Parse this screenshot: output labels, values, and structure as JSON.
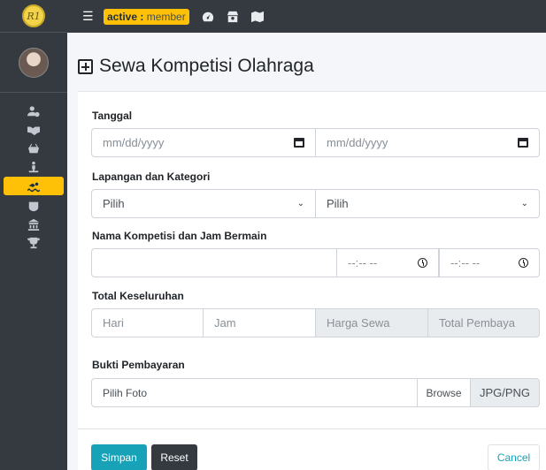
{
  "brand": {
    "logo_text": "R1"
  },
  "sidebar": {
    "items": [
      {
        "icon": "user-cog-icon"
      },
      {
        "icon": "handshake-icon"
      },
      {
        "icon": "basket-icon"
      },
      {
        "icon": "person-icon"
      },
      {
        "icon": "swimmer-icon",
        "active": true
      },
      {
        "icon": "fist-icon"
      },
      {
        "icon": "building-icon"
      },
      {
        "icon": "trophy-icon"
      }
    ]
  },
  "topbar": {
    "badge_prefix": "active : ",
    "badge_role": "member",
    "icons": [
      "dashboard-icon",
      "store-icon",
      "map-icon"
    ]
  },
  "page": {
    "title": "Sewa Kompetisi Olahraga"
  },
  "form": {
    "tanggal": {
      "label": "Tanggal",
      "date1_placeholder": "mm/dd/yyyy",
      "date2_placeholder": "mm/dd/yyyy"
    },
    "lapangan": {
      "label": "Lapangan dan Kategori",
      "select1_value": "Pilih",
      "select2_value": "Pilih"
    },
    "kompetisi": {
      "label": "Nama Kompetisi dan Jam Bermain",
      "name_value": "",
      "time1_placeholder": "--:-- --",
      "time2_placeholder": "--:-- --"
    },
    "total": {
      "label": "Total Keseluruhan",
      "hari_placeholder": "Hari",
      "jam_placeholder": "Jam",
      "harga_placeholder": "Harga Sewa",
      "total_placeholder": "Total Pembaya"
    },
    "bukti": {
      "label": "Bukti Pembayaran",
      "file_placeholder": "Pilih Foto",
      "browse_label": "Browse",
      "ext_label": "JPG/PNG"
    }
  },
  "buttons": {
    "save": "Simpan",
    "reset": "Reset",
    "cancel": "Cancel"
  },
  "colors": {
    "accent": "#ffc107",
    "primary": "#17a2b8",
    "dark": "#343a40"
  }
}
